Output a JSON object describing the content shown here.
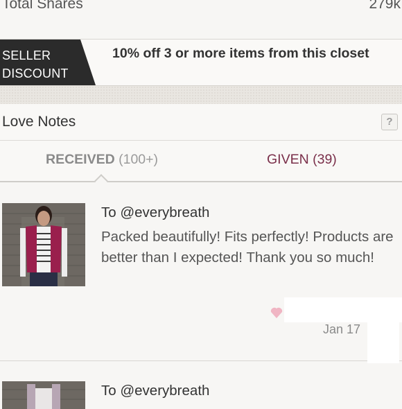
{
  "shares": {
    "label": "Total Shares",
    "value": "279k"
  },
  "seller_discount": {
    "badge_line1": "SELLER",
    "badge_line2": "DISCOUNT",
    "message": "10% off 3 or more items from this closet",
    "badge_color": "#2b2b2b"
  },
  "love_notes": {
    "title": "Love Notes",
    "help_label": "?",
    "tabs": [
      {
        "label": "RECEIVED",
        "count": "(100+)"
      },
      {
        "label": "GIVEN",
        "count": "(39)"
      }
    ],
    "notes": [
      {
        "to": "To @everybreath",
        "text": "Packed beautifully! Fits perfectly! Products are better than I expected! Thank you so much!",
        "date": "Jan 17",
        "icon": "heart-icon"
      },
      {
        "to": "To @everybreath"
      }
    ]
  },
  "colors": {
    "accent": "#7a2f4a",
    "heart": "#f0b5c3"
  }
}
